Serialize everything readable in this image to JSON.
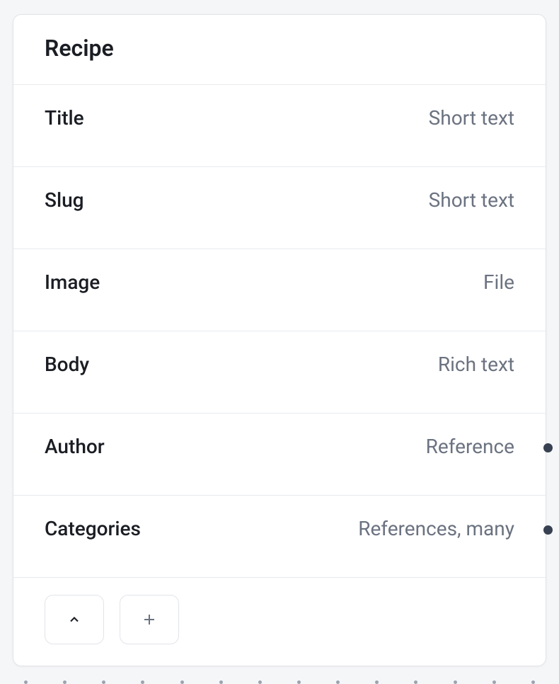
{
  "card": {
    "title": "Recipe"
  },
  "fields": [
    {
      "name": "Title",
      "type": "Short text",
      "hasReference": false
    },
    {
      "name": "Slug",
      "type": "Short text",
      "hasReference": false
    },
    {
      "name": "Image",
      "type": "File",
      "hasReference": false
    },
    {
      "name": "Body",
      "type": "Rich text",
      "hasReference": false
    },
    {
      "name": "Author",
      "type": "Reference",
      "hasReference": true
    },
    {
      "name": "Categories",
      "type": "References, many",
      "hasReference": true
    }
  ]
}
